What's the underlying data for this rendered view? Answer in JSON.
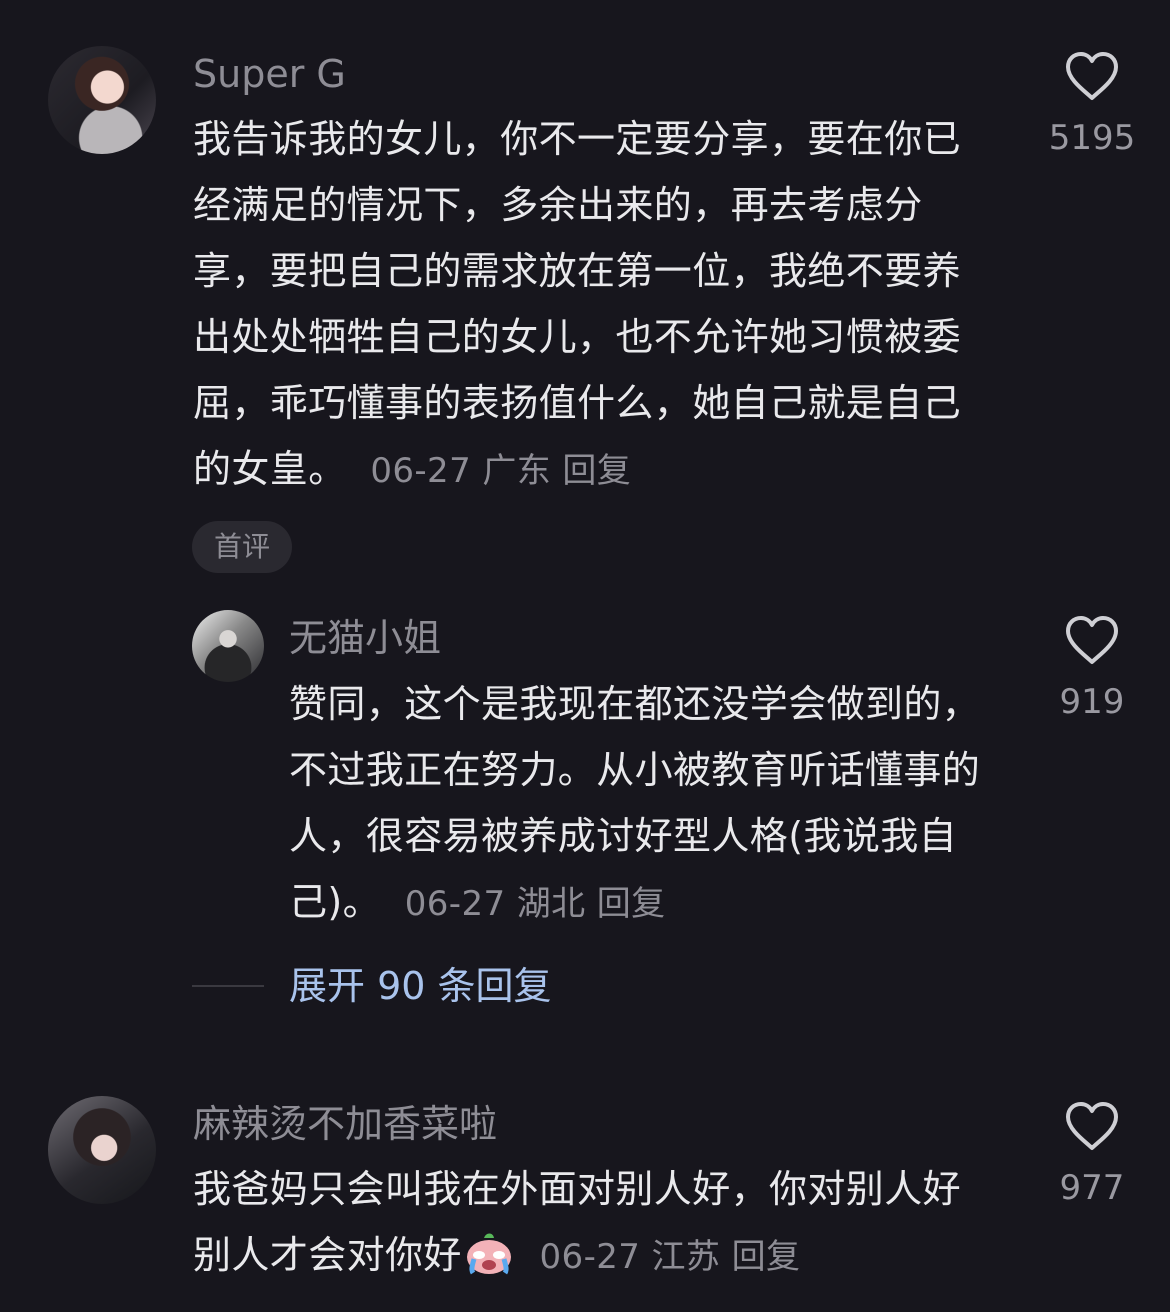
{
  "comments": [
    {
      "username": "Super G",
      "text": "我告诉我的女儿，你不一定要分享，要在你已经满足的情况下，多余出来的，再去考虑分享，要把自己的需求放在第一位，我绝不要养出处处牺牲自己的女儿，也不允许她习惯被委屈，乖巧懂事的表扬值什么，她自己就是自己的女皇。",
      "date": "06-27",
      "location": "广东",
      "reply_label": "回复",
      "badge": "首评",
      "likes": "5195",
      "icons": {
        "like": "heart-outline-icon",
        "avatar": "user-avatar"
      }
    },
    {
      "username": "无猫小姐",
      "text": "赞同，这个是我现在都还没学会做到的，不过我正在努力。从小被教育听话懂事的人，很容易被养成讨好型人格(我说我自己)。",
      "date": "06-27",
      "location": "湖北",
      "reply_label": "回复",
      "likes": "919",
      "icons": {
        "like": "heart-outline-icon",
        "avatar": "user-avatar"
      }
    },
    {
      "username": "麻辣烫不加香菜啦",
      "text": "我爸妈只会叫我在外面对别人好，你对别人好别人才会对你好",
      "emoji": "crying-face-emoji",
      "date": "06-27",
      "location": "江苏",
      "reply_label": "回复",
      "likes": "977",
      "icons": {
        "like": "heart-outline-icon",
        "avatar": "user-avatar"
      }
    }
  ],
  "replies": {
    "expand_label": "展开 90 条回复"
  },
  "colors": {
    "background": "#17161d",
    "text": "#e9e9ec",
    "muted": "#8e8d95",
    "link": "#a9c3ec",
    "badge_bg": "#2a2930"
  }
}
